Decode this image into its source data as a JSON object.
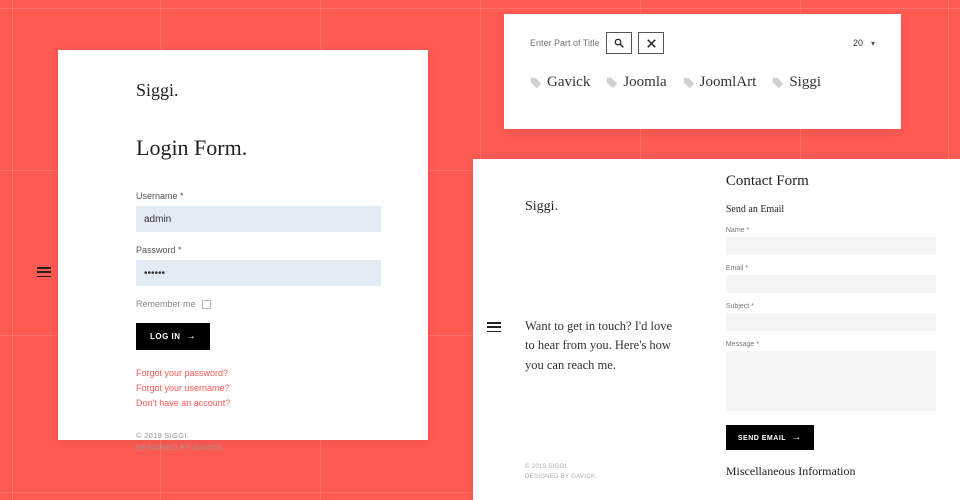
{
  "login": {
    "logo": "Siggi.",
    "heading": "Login Form.",
    "username_label": "Username *",
    "username_value": "admin",
    "password_label": "Password *",
    "password_value": "••••••",
    "remember_label": "Remember me",
    "button_label": "LOG IN",
    "links": {
      "forgot_password": "Forgot your password?",
      "forgot_username": "Forgot your username?",
      "no_account": "Don't have an account?"
    },
    "footer_line1": "© 2019 SIGGI.",
    "footer_line2": "DESIGNED BY GAVICK."
  },
  "filter": {
    "placeholder": "Enter Part of Title",
    "per_page": "20",
    "tags": [
      "Gavick",
      "Joomla",
      "JoomlArt",
      "Siggi"
    ]
  },
  "contact": {
    "logo": "Siggi.",
    "blurb": "Want to get in touch? I'd love to hear from you. Here's how you can reach me.",
    "footer_line1": "© 2019 SIGGI.",
    "footer_line2": "DESIGNED BY GAVICK.",
    "form_heading": "Contact Form",
    "send_email_label": "Send an Email",
    "name_label": "Name *",
    "email_label": "Email *",
    "subject_label": "Subject *",
    "message_label": "Message *",
    "send_button": "SEND EMAIL",
    "misc_heading": "Miscellaneous Information"
  }
}
